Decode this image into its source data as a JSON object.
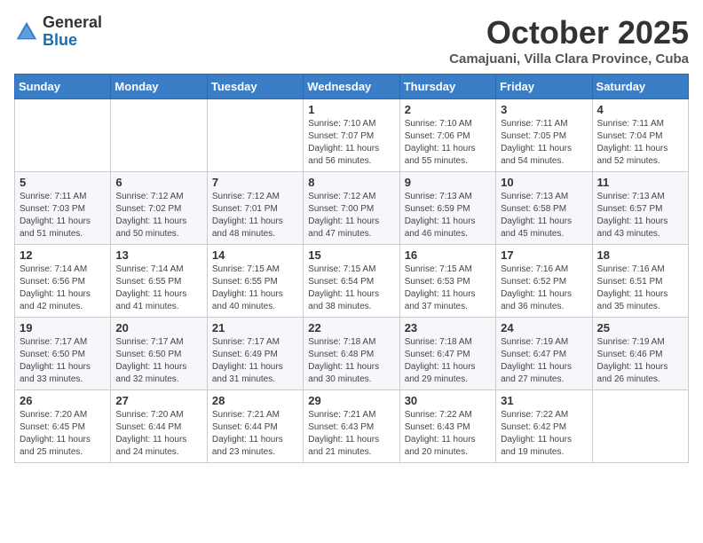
{
  "header": {
    "logo_general": "General",
    "logo_blue": "Blue",
    "month_title": "October 2025",
    "subtitle": "Camajuani, Villa Clara Province, Cuba"
  },
  "days_of_week": [
    "Sunday",
    "Monday",
    "Tuesday",
    "Wednesday",
    "Thursday",
    "Friday",
    "Saturday"
  ],
  "weeks": [
    [
      {
        "day": "",
        "info": ""
      },
      {
        "day": "",
        "info": ""
      },
      {
        "day": "",
        "info": ""
      },
      {
        "day": "1",
        "info": "Sunrise: 7:10 AM\nSunset: 7:07 PM\nDaylight: 11 hours and 56 minutes."
      },
      {
        "day": "2",
        "info": "Sunrise: 7:10 AM\nSunset: 7:06 PM\nDaylight: 11 hours and 55 minutes."
      },
      {
        "day": "3",
        "info": "Sunrise: 7:11 AM\nSunset: 7:05 PM\nDaylight: 11 hours and 54 minutes."
      },
      {
        "day": "4",
        "info": "Sunrise: 7:11 AM\nSunset: 7:04 PM\nDaylight: 11 hours and 52 minutes."
      }
    ],
    [
      {
        "day": "5",
        "info": "Sunrise: 7:11 AM\nSunset: 7:03 PM\nDaylight: 11 hours and 51 minutes."
      },
      {
        "day": "6",
        "info": "Sunrise: 7:12 AM\nSunset: 7:02 PM\nDaylight: 11 hours and 50 minutes."
      },
      {
        "day": "7",
        "info": "Sunrise: 7:12 AM\nSunset: 7:01 PM\nDaylight: 11 hours and 48 minutes."
      },
      {
        "day": "8",
        "info": "Sunrise: 7:12 AM\nSunset: 7:00 PM\nDaylight: 11 hours and 47 minutes."
      },
      {
        "day": "9",
        "info": "Sunrise: 7:13 AM\nSunset: 6:59 PM\nDaylight: 11 hours and 46 minutes."
      },
      {
        "day": "10",
        "info": "Sunrise: 7:13 AM\nSunset: 6:58 PM\nDaylight: 11 hours and 45 minutes."
      },
      {
        "day": "11",
        "info": "Sunrise: 7:13 AM\nSunset: 6:57 PM\nDaylight: 11 hours and 43 minutes."
      }
    ],
    [
      {
        "day": "12",
        "info": "Sunrise: 7:14 AM\nSunset: 6:56 PM\nDaylight: 11 hours and 42 minutes."
      },
      {
        "day": "13",
        "info": "Sunrise: 7:14 AM\nSunset: 6:55 PM\nDaylight: 11 hours and 41 minutes."
      },
      {
        "day": "14",
        "info": "Sunrise: 7:15 AM\nSunset: 6:55 PM\nDaylight: 11 hours and 40 minutes."
      },
      {
        "day": "15",
        "info": "Sunrise: 7:15 AM\nSunset: 6:54 PM\nDaylight: 11 hours and 38 minutes."
      },
      {
        "day": "16",
        "info": "Sunrise: 7:15 AM\nSunset: 6:53 PM\nDaylight: 11 hours and 37 minutes."
      },
      {
        "day": "17",
        "info": "Sunrise: 7:16 AM\nSunset: 6:52 PM\nDaylight: 11 hours and 36 minutes."
      },
      {
        "day": "18",
        "info": "Sunrise: 7:16 AM\nSunset: 6:51 PM\nDaylight: 11 hours and 35 minutes."
      }
    ],
    [
      {
        "day": "19",
        "info": "Sunrise: 7:17 AM\nSunset: 6:50 PM\nDaylight: 11 hours and 33 minutes."
      },
      {
        "day": "20",
        "info": "Sunrise: 7:17 AM\nSunset: 6:50 PM\nDaylight: 11 hours and 32 minutes."
      },
      {
        "day": "21",
        "info": "Sunrise: 7:17 AM\nSunset: 6:49 PM\nDaylight: 11 hours and 31 minutes."
      },
      {
        "day": "22",
        "info": "Sunrise: 7:18 AM\nSunset: 6:48 PM\nDaylight: 11 hours and 30 minutes."
      },
      {
        "day": "23",
        "info": "Sunrise: 7:18 AM\nSunset: 6:47 PM\nDaylight: 11 hours and 29 minutes."
      },
      {
        "day": "24",
        "info": "Sunrise: 7:19 AM\nSunset: 6:47 PM\nDaylight: 11 hours and 27 minutes."
      },
      {
        "day": "25",
        "info": "Sunrise: 7:19 AM\nSunset: 6:46 PM\nDaylight: 11 hours and 26 minutes."
      }
    ],
    [
      {
        "day": "26",
        "info": "Sunrise: 7:20 AM\nSunset: 6:45 PM\nDaylight: 11 hours and 25 minutes."
      },
      {
        "day": "27",
        "info": "Sunrise: 7:20 AM\nSunset: 6:44 PM\nDaylight: 11 hours and 24 minutes."
      },
      {
        "day": "28",
        "info": "Sunrise: 7:21 AM\nSunset: 6:44 PM\nDaylight: 11 hours and 23 minutes."
      },
      {
        "day": "29",
        "info": "Sunrise: 7:21 AM\nSunset: 6:43 PM\nDaylight: 11 hours and 21 minutes."
      },
      {
        "day": "30",
        "info": "Sunrise: 7:22 AM\nSunset: 6:43 PM\nDaylight: 11 hours and 20 minutes."
      },
      {
        "day": "31",
        "info": "Sunrise: 7:22 AM\nSunset: 6:42 PM\nDaylight: 11 hours and 19 minutes."
      },
      {
        "day": "",
        "info": ""
      }
    ]
  ]
}
